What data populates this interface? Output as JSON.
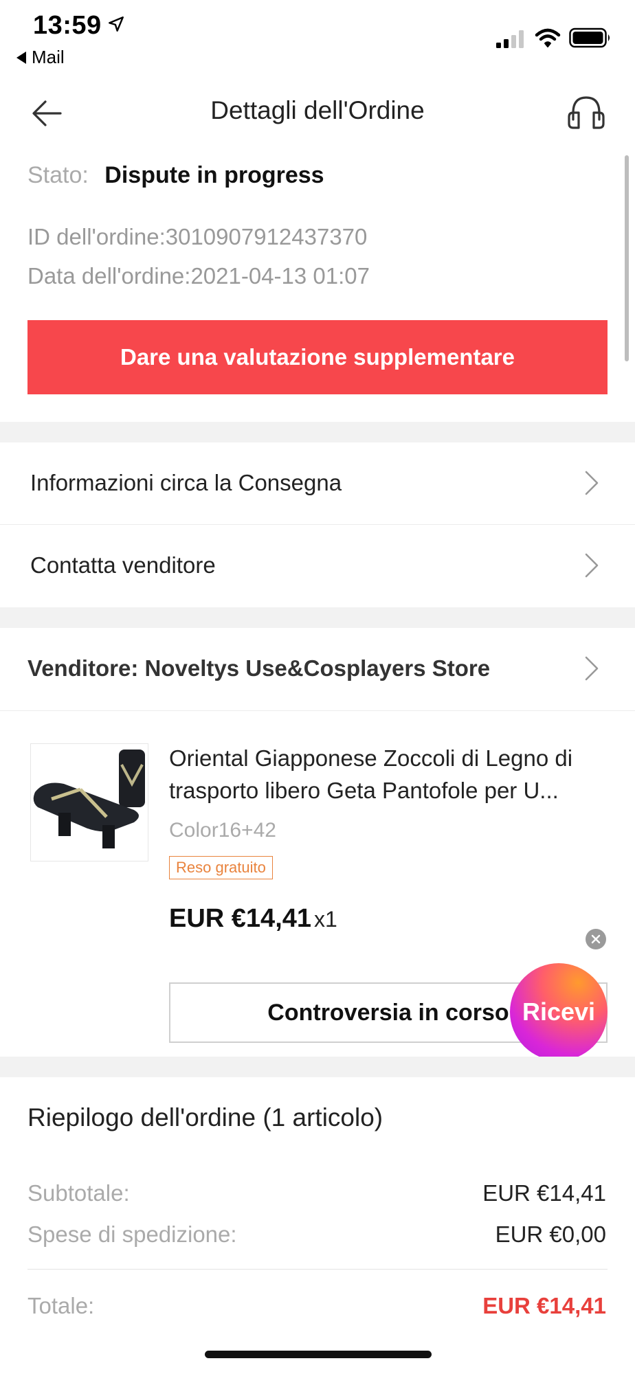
{
  "status_bar": {
    "time": "13:59",
    "back_app": "Mail",
    "icons": [
      "location-arrow-icon",
      "signal-icon",
      "wifi-icon",
      "battery-icon"
    ]
  },
  "header": {
    "title": "Dettagli dell'Ordine",
    "back_icon": "arrow-left-icon",
    "support_icon": "headset-icon"
  },
  "order": {
    "status_label": "Stato:",
    "status_value": "Dispute in progress",
    "id_text": "ID dell'ordine:3010907912437370",
    "date_text": "Data dell'ordine:2021-04-13 01:07",
    "review_button": "Dare una valutazione supplementare"
  },
  "links": {
    "delivery_info": "Informazioni circa la Consegna",
    "contact_seller": "Contatta venditore"
  },
  "seller": {
    "label": "Venditore: Noveltys Use&Cosplayers Store"
  },
  "product": {
    "title": "Oriental Giapponese Zoccoli di Legno di trasporto libero Geta Pantofole per U...",
    "variant": "Color16+42",
    "badge": "Reso gratuito",
    "price": "EUR €14,41",
    "qty": "x1",
    "dispute_button": "Controversia in corso",
    "promo_bubble": "Ricevi"
  },
  "summary": {
    "title": "Riepilogo dell'ordine (1 articolo)",
    "subtotal_label": "Subtotale:",
    "subtotal_value": "EUR €14,41",
    "shipping_label": "Spese di spedizione:",
    "shipping_value": "EUR €0,00",
    "total_label": "Totale:",
    "total_value": "EUR €14,41"
  },
  "colors": {
    "accent_red": "#f7474c",
    "total_red": "#e8403c",
    "badge_orange": "#e9833d"
  }
}
